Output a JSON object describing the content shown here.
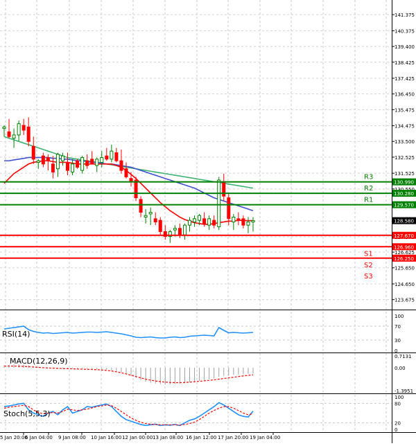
{
  "chart_data": {
    "type": "candlestick",
    "main": {
      "ylim": [
        123.1,
        142.2
      ],
      "price_ticks": [
        "141.375",
        "140.375",
        "139.400",
        "138.425",
        "137.425",
        "136.450",
        "135.475",
        "134.475",
        "133.500",
        "132.525",
        "131.525",
        "130.550",
        "128.550",
        "127.575",
        "126.625",
        "125.650",
        "124.650",
        "123.675"
      ],
      "candles": [
        [
          134.3,
          134.5,
          133.8,
          134.4
        ],
        [
          134.1,
          134.9,
          133.7,
          133.8
        ],
        [
          133.7,
          134.3,
          133.1,
          133.9
        ],
        [
          133.9,
          134.8,
          133.5,
          134.6
        ],
        [
          134.5,
          134.9,
          133.9,
          134.2
        ],
        [
          134.4,
          135.0,
          133.2,
          133.5
        ],
        [
          133.2,
          133.8,
          132.1,
          132.4
        ],
        [
          132.2,
          132.4,
          131.8,
          132.3
        ],
        [
          132.6,
          132.8,
          131.9,
          132.1
        ],
        [
          132.5,
          132.7,
          131.7,
          132.3
        ],
        [
          132.1,
          132.6,
          131.2,
          131.6
        ],
        [
          131.8,
          132.8,
          131.3,
          132.7
        ],
        [
          132.3,
          132.8,
          132.0,
          132.6
        ],
        [
          132.2,
          132.8,
          131.4,
          131.7
        ],
        [
          131.6,
          132.4,
          131.4,
          132.1
        ],
        [
          132.3,
          132.4,
          131.8,
          131.9
        ],
        [
          131.7,
          132.6,
          131.5,
          132.5
        ],
        [
          132.3,
          132.7,
          131.8,
          132.0
        ],
        [
          132.4,
          132.9,
          132.1,
          132.1
        ],
        [
          132.0,
          132.5,
          131.6,
          132.4
        ],
        [
          132.2,
          132.9,
          131.9,
          132.5
        ],
        [
          132.6,
          133.1,
          132.3,
          132.4
        ],
        [
          132.4,
          133.3,
          132.2,
          132.9
        ],
        [
          132.8,
          133.1,
          132.2,
          132.3
        ],
        [
          132.3,
          133.0,
          131.5,
          131.7
        ],
        [
          131.8,
          132.2,
          131.2,
          131.3
        ],
        [
          131.2,
          131.6,
          130.7,
          131.0
        ],
        [
          131.1,
          131.3,
          129.8,
          130.0
        ],
        [
          129.9,
          130.1,
          128.8,
          129.1
        ],
        [
          128.8,
          129.3,
          128.4,
          128.9
        ],
        [
          129.0,
          129.4,
          128.3,
          129.1
        ],
        [
          128.7,
          129.1,
          128.3,
          128.5
        ],
        [
          128.6,
          128.8,
          127.7,
          127.9
        ],
        [
          127.9,
          128.3,
          127.4,
          127.6
        ],
        [
          127.6,
          128.0,
          127.2,
          127.9
        ],
        [
          128.0,
          128.3,
          127.6,
          128.1
        ],
        [
          128.1,
          128.4,
          127.5,
          127.7
        ],
        [
          127.7,
          128.4,
          127.4,
          128.3
        ],
        [
          128.3,
          128.8,
          127.9,
          128.6
        ],
        [
          128.5,
          128.9,
          128.2,
          128.7
        ],
        [
          128.6,
          129.0,
          128.3,
          128.9
        ],
        [
          128.7,
          129.1,
          128.2,
          128.4
        ],
        [
          128.3,
          128.9,
          128.0,
          128.7
        ],
        [
          128.6,
          128.9,
          128.1,
          128.3
        ],
        [
          128.2,
          131.3,
          128.0,
          131.1
        ],
        [
          131.0,
          131.5,
          129.8,
          130.1
        ],
        [
          130.0,
          130.3,
          128.3,
          128.7
        ],
        [
          128.5,
          129.0,
          128.0,
          128.8
        ],
        [
          128.7,
          129.1,
          128.3,
          128.6
        ],
        [
          128.7,
          128.9,
          128.1,
          128.3
        ],
        [
          128.3,
          128.8,
          127.8,
          128.5
        ],
        [
          128.5,
          128.8,
          127.9,
          128.58
        ]
      ],
      "ma_red": [
        130.9,
        131.2,
        131.5,
        131.7,
        131.9,
        132.1,
        132.2,
        132.25,
        132.3,
        132.3,
        132.25,
        132.2,
        132.2,
        132.2,
        132.15,
        132.1,
        132.1,
        132.1,
        132.1,
        132.1,
        132.1,
        132.1,
        132.1,
        132.0,
        131.9,
        131.7,
        131.45,
        131.2,
        130.9,
        130.6,
        130.3,
        130.0,
        129.7,
        129.45,
        129.2,
        129.0,
        128.8,
        128.65,
        128.55,
        128.45,
        128.4,
        128.35,
        128.35,
        128.4,
        128.45,
        128.5,
        128.55,
        128.55,
        128.6,
        128.6,
        128.58,
        128.58
      ],
      "ma_blue": [
        132.3,
        132.3,
        132.35,
        132.4,
        132.45,
        132.5,
        132.5,
        132.5,
        132.5,
        132.5,
        132.45,
        132.45,
        132.4,
        132.4,
        132.35,
        132.3,
        132.3,
        132.25,
        132.2,
        132.2,
        132.15,
        132.1,
        132.1,
        132.05,
        132.0,
        131.95,
        131.9,
        131.8,
        131.7,
        131.6,
        131.5,
        131.4,
        131.3,
        131.2,
        131.1,
        131.0,
        130.9,
        130.8,
        130.7,
        130.6,
        130.45,
        130.3,
        130.15,
        130.0,
        129.9,
        129.8,
        129.7,
        129.6,
        129.5,
        129.4,
        129.3,
        129.2
      ],
      "ma_green": [
        133.8,
        133.7,
        133.6,
        133.5,
        133.4,
        133.3,
        133.2,
        133.1,
        133.0,
        132.9,
        132.8,
        132.7,
        132.6,
        132.5,
        132.45,
        132.4,
        132.35,
        132.3,
        132.25,
        132.2,
        132.15,
        132.1,
        132.05,
        132.0,
        131.95,
        131.9,
        131.85,
        131.8,
        131.75,
        131.7,
        131.65,
        131.6,
        131.55,
        131.5,
        131.45,
        131.4,
        131.35,
        131.3,
        131.25,
        131.2,
        131.15,
        131.1,
        131.05,
        131.0,
        130.95,
        130.9,
        130.85,
        130.8,
        130.75,
        130.7,
        130.65,
        130.6
      ],
      "levels": [
        {
          "name": "R3",
          "value": 130.99,
          "label": "130.990",
          "color": "#008000"
        },
        {
          "name": "R2",
          "value": 130.28,
          "label": "130.280",
          "color": "#008000"
        },
        {
          "name": "R1",
          "value": 129.57,
          "label": "129.570",
          "color": "#008000"
        },
        {
          "name": "",
          "value": 127.67,
          "label": "127.670",
          "color": "#ff0000"
        },
        {
          "name": "S1",
          "value": 126.96,
          "label": "126.960",
          "color": "#ff0000"
        },
        {
          "name": "S2",
          "value": 126.25,
          "label": "126.250",
          "color": "#ff0000"
        }
      ],
      "s3_label": "S3",
      "current_price": "128.580",
      "colors": {
        "bull": "#008000",
        "bear": "#ff0000",
        "ma_red": "#ff0000",
        "ma_blue": "#3f51d0",
        "ma_green": "#3cb371"
      }
    },
    "rsi": {
      "label": "RSI(14)",
      "ticks": [
        "100",
        "70",
        "30",
        "0"
      ],
      "values": [
        62,
        64,
        66,
        68,
        70,
        60,
        55,
        52,
        50,
        51,
        49,
        50,
        51,
        52,
        50,
        51,
        52,
        53,
        53,
        52,
        53,
        54,
        52,
        50,
        48,
        45,
        42,
        38,
        37,
        38,
        39,
        37,
        36,
        36,
        38,
        39,
        37,
        38,
        41,
        42,
        43,
        44,
        43,
        42,
        66,
        58,
        51,
        52,
        51,
        50,
        51,
        52
      ]
    },
    "macd": {
      "label": "MACD(12,26,9)",
      "ticks": [
        "0.7131",
        "0.00",
        "-1.3951"
      ],
      "histogram": [
        0.15,
        0.18,
        0.2,
        0.2,
        0.19,
        0.15,
        0.1,
        0.05,
        0.0,
        -0.02,
        -0.04,
        -0.05,
        -0.05,
        -0.06,
        -0.06,
        -0.07,
        -0.08,
        -0.08,
        -0.09,
        -0.1,
        -0.1,
        -0.12,
        -0.15,
        -0.2,
        -0.28,
        -0.38,
        -0.5,
        -0.62,
        -0.75,
        -0.85,
        -0.92,
        -0.97,
        -1.0,
        -1.02,
        -1.02,
        -1.0,
        -0.98,
        -0.95,
        -0.9,
        -0.85,
        -0.8,
        -0.75,
        -0.7,
        -0.66,
        -0.55,
        -0.5,
        -0.47,
        -0.44,
        -0.42,
        -0.4,
        -0.38,
        -0.36
      ],
      "signal": [
        0.1,
        0.1,
        0.1,
        0.09,
        0.08,
        0.06,
        0.04,
        0.02,
        0.0,
        -0.02,
        -0.03,
        -0.04,
        -0.05,
        -0.06,
        -0.07,
        -0.08,
        -0.09,
        -0.1,
        -0.11,
        -0.12,
        -0.14,
        -0.17,
        -0.2,
        -0.25,
        -0.31,
        -0.38,
        -0.46,
        -0.54,
        -0.62,
        -0.7,
        -0.76,
        -0.81,
        -0.85,
        -0.88,
        -0.9,
        -0.91,
        -0.91,
        -0.9,
        -0.88,
        -0.86,
        -0.83,
        -0.8,
        -0.77,
        -0.74,
        -0.7,
        -0.66,
        -0.62,
        -0.58,
        -0.54,
        -0.5,
        -0.47,
        -0.44
      ]
    },
    "stoch": {
      "label": "Stoch(5,5,3)",
      "ticks": [
        "100",
        "80",
        "20",
        "0"
      ],
      "main": [
        70,
        72,
        75,
        78,
        80,
        60,
        50,
        45,
        40,
        50,
        55,
        45,
        60,
        70,
        50,
        55,
        60,
        70,
        68,
        72,
        75,
        78,
        70,
        55,
        40,
        30,
        25,
        20,
        15,
        12,
        14,
        16,
        12,
        14,
        13,
        15,
        12,
        20,
        28,
        32,
        40,
        50,
        60,
        70,
        82,
        75,
        65,
        55,
        45,
        40,
        38,
        56
      ],
      "signal": [
        65,
        68,
        70,
        72,
        74,
        70,
        60,
        52,
        48,
        50,
        52,
        50,
        55,
        62,
        60,
        58,
        60,
        62,
        66,
        70,
        72,
        75,
        73,
        65,
        55,
        45,
        35,
        28,
        22,
        18,
        16,
        15,
        14,
        14,
        14,
        14,
        13,
        15,
        18,
        22,
        30,
        40,
        50,
        58,
        65,
        70,
        70,
        65,
        58,
        50,
        45,
        48
      ]
    },
    "x_ticks": [
      "5 Jan 20:00",
      "6 Jan 04:00",
      "9 Jan 08:00",
      "10 Jan 16:00",
      "12 Jan 00:00",
      "13 Jan 08:00",
      "16 Jan 12:00",
      "17 Jan 20:00",
      "19 Jan 04:00"
    ]
  }
}
